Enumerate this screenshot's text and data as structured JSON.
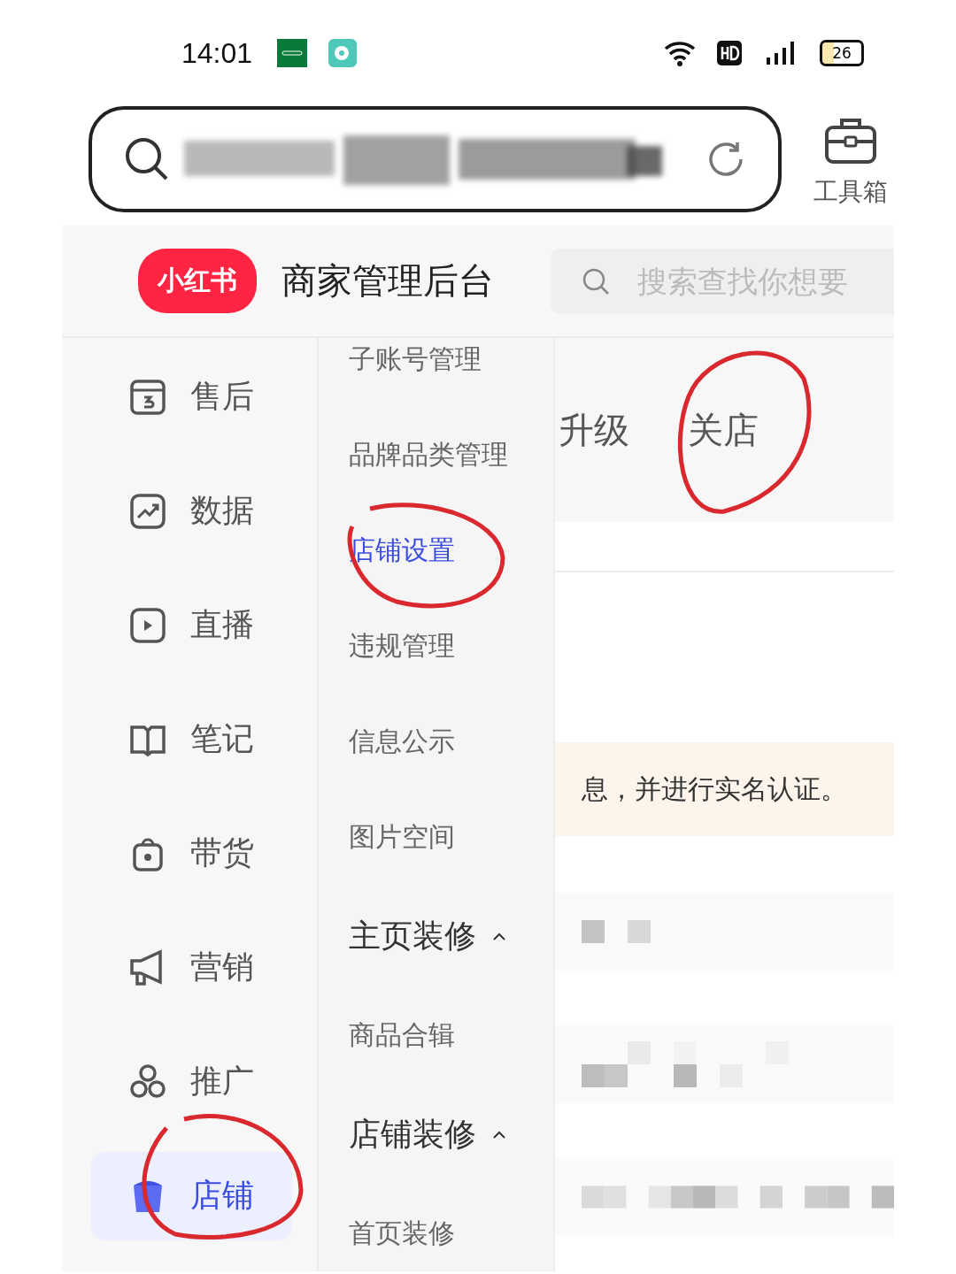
{
  "status_bar": {
    "time": "14:01",
    "battery": "26"
  },
  "browser": {
    "toolbox_label": "工具箱"
  },
  "header": {
    "logo": "小红书",
    "title": "商家管理后台",
    "search": {
      "placeholder": "搜索查找你想要"
    }
  },
  "sidebar": {
    "items": [
      {
        "label": "售后",
        "kind": "aftersale",
        "selected": false
      },
      {
        "label": "数据",
        "kind": "chart",
        "selected": false
      },
      {
        "label": "直播",
        "kind": "play",
        "selected": false
      },
      {
        "label": "笔记",
        "kind": "book",
        "selected": false
      },
      {
        "label": "带货",
        "kind": "bag",
        "selected": false
      },
      {
        "label": "营销",
        "kind": "megaphone",
        "selected": false
      },
      {
        "label": "推广",
        "kind": "clover",
        "selected": false
      },
      {
        "label": "店铺",
        "kind": "shop",
        "selected": true
      }
    ]
  },
  "submenu": {
    "items": [
      {
        "label": "子账号管理",
        "kind": "link",
        "selected": false
      },
      {
        "label": "品牌品类管理",
        "kind": "link",
        "selected": false
      },
      {
        "label": "店铺设置",
        "kind": "link",
        "selected": true
      },
      {
        "label": "违规管理",
        "kind": "link",
        "selected": false
      },
      {
        "label": "信息公示",
        "kind": "link",
        "selected": false
      },
      {
        "label": "图片空间",
        "kind": "link",
        "selected": false
      },
      {
        "label": "主页装修",
        "kind": "group",
        "expanded": true
      },
      {
        "label": "商品合辑",
        "kind": "link",
        "selected": false
      },
      {
        "label": "店铺装修",
        "kind": "group",
        "expanded": true
      },
      {
        "label": "首页装修",
        "kind": "link",
        "selected": false
      }
    ]
  },
  "content": {
    "tabs": [
      {
        "label": "升级",
        "selected": false
      },
      {
        "label": "关店",
        "selected": false
      }
    ],
    "notice": "息，并进行实名认证。"
  }
}
